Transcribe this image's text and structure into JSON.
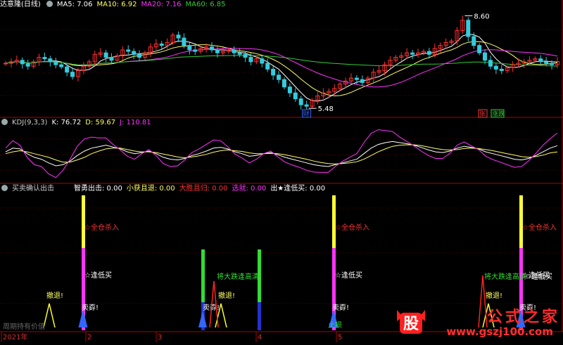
{
  "window": {
    "title": "达意隆(日线)"
  },
  "price_panel": {
    "title": "达意隆(日线)",
    "indicators": [
      {
        "label": "MA5: 7.06",
        "color": "#ffffff"
      },
      {
        "label": "MA10: 6.92",
        "color": "#ffff66"
      },
      {
        "label": "MA20: 7.16",
        "color": "#ff33ff"
      },
      {
        "label": "MA60: 6.85",
        "color": "#33cc33"
      }
    ],
    "high_label": "8.60",
    "low_label": "5.48",
    "tags": [
      {
        "text": "财",
        "color": "#3366ff"
      },
      {
        "text": "张",
        "color": "#ff3333"
      },
      {
        "text": "涨跌",
        "color": "#33cc33"
      }
    ]
  },
  "kdj_panel": {
    "title": "KDJ(9,3,3)",
    "indicators": [
      {
        "label": "K: 76.72",
        "color": "#ffffff"
      },
      {
        "label": "D: 59.67",
        "color": "#ffff66"
      },
      {
        "label": "J: 110.81",
        "color": "#ff33ff"
      }
    ]
  },
  "signal_panel": {
    "title": "买卖确认出击",
    "indicators": [
      {
        "label": "智勇出击: 0.00",
        "color": "#ffffff"
      },
      {
        "label": "小获且退: 0.00",
        "color": "#ffff66"
      },
      {
        "label": "大胜且归: 0.00",
        "color": "#ff3333"
      },
      {
        "label": "选就: 0.00",
        "color": "#ff33ff"
      },
      {
        "label": "出★逢低买: 0.00",
        "color": "#ffffff"
      }
    ],
    "labels": {
      "full_buy": "☆全仓杀入",
      "dip_buy": "☆逢低买",
      "retreat": "撤退!",
      "sell": "卖孬!",
      "big_drop": "将大跌逢高清",
      "stop_loss": "止损",
      "blurred": "周期持有价值"
    }
  },
  "x_axis": {
    "labels": [
      "2021年",
      "2",
      "3",
      "4",
      "5"
    ]
  },
  "watermark": {
    "text": "公式之家",
    "url": "www.gszj100.com",
    "logo": "股"
  },
  "chart_data": [
    {
      "type": "candlestick",
      "title": "达意隆(日线)",
      "series_names": [
        "MA5",
        "MA10",
        "MA20",
        "MA60"
      ],
      "x": [
        "2021年",
        "2",
        "3",
        "4",
        "5"
      ],
      "ylim": [
        5.2,
        8.8
      ],
      "annotated_high": 8.6,
      "annotated_low": 5.48,
      "ma_values_last": {
        "MA5": 7.06,
        "MA10": 6.92,
        "MA20": 7.16,
        "MA60": 6.85
      },
      "close": [
        7.0,
        7.05,
        7.1,
        6.98,
        6.9,
        7.05,
        7.2,
        7.15,
        7.05,
        6.95,
        6.88,
        6.7,
        6.55,
        6.75,
        6.9,
        7.05,
        7.3,
        7.35,
        7.2,
        7.1,
        7.25,
        7.45,
        7.4,
        7.3,
        7.2,
        7.35,
        7.55,
        7.65,
        7.6,
        7.7,
        7.95,
        7.85,
        7.6,
        7.45,
        7.4,
        7.5,
        7.55,
        7.45,
        7.35,
        7.4,
        7.45,
        7.35,
        7.3,
        7.2,
        7.05,
        7.15,
        7.0,
        6.8,
        6.6,
        6.45,
        6.2,
        6.0,
        5.8,
        5.6,
        5.55,
        5.75,
        5.9,
        6.0,
        6.05,
        6.15,
        6.3,
        6.4,
        6.5,
        6.45,
        6.35,
        6.5,
        6.7,
        6.75,
        6.95,
        7.1,
        7.2,
        7.25,
        7.35,
        7.3,
        7.35,
        7.4,
        7.3,
        7.5,
        7.6,
        7.7,
        7.75,
        8.1,
        8.45,
        7.9,
        7.6,
        7.35,
        7.1,
        6.9,
        6.8,
        6.75,
        6.85,
        6.95,
        7.0,
        7.05,
        7.1,
        7.15,
        7.05,
        7.0,
        6.95,
        7.06
      ]
    },
    {
      "type": "line",
      "title": "KDJ(9,3,3)",
      "series": [
        {
          "name": "K",
          "values": [
            60,
            70,
            68,
            55,
            45,
            40,
            30,
            22,
            25,
            35,
            50,
            62,
            70,
            74,
            78,
            73,
            68,
            60,
            55,
            58,
            62,
            55,
            45,
            40,
            38,
            42,
            50,
            55,
            62,
            70,
            72,
            68,
            60,
            55,
            48,
            50,
            55,
            58,
            52,
            45,
            40,
            35,
            30,
            25,
            22,
            20,
            25,
            30,
            35,
            40,
            55,
            70,
            80,
            85,
            88,
            85,
            82,
            78,
            72,
            65,
            60,
            58,
            62,
            70,
            75,
            72,
            68,
            60,
            55,
            50,
            45,
            40,
            38,
            42,
            50,
            60,
            70,
            76.72
          ]
        },
        {
          "name": "D",
          "values": [
            55,
            60,
            63,
            60,
            55,
            50,
            45,
            38,
            32,
            32,
            38,
            45,
            55,
            62,
            68,
            70,
            70,
            66,
            62,
            60,
            60,
            58,
            54,
            50,
            46,
            44,
            46,
            49,
            53,
            59,
            63,
            65,
            63,
            61,
            57,
            55,
            55,
            56,
            55,
            52,
            48,
            44,
            40,
            35,
            31,
            28,
            27,
            28,
            30,
            33,
            40,
            50,
            60,
            68,
            75,
            78,
            79,
            79,
            77,
            73,
            69,
            66,
            65,
            66,
            69,
            70,
            69,
            66,
            63,
            59,
            55,
            51,
            47,
            45,
            47,
            51,
            57,
            59.67
          ]
        },
        {
          "name": "J",
          "values": [
            70,
            90,
            78,
            45,
            25,
            20,
            0,
            -10,
            10,
            40,
            75,
            95,
            100,
            98,
            98,
            80,
            65,
            48,
            40,
            55,
            66,
            50,
            28,
            20,
            22,
            38,
            58,
            68,
            80,
            92,
            90,
            74,
            54,
            43,
            30,
            40,
            55,
            62,
            46,
            32,
            24,
            18,
            10,
            5,
            4,
            4,
            20,
            34,
            45,
            55,
            85,
            110,
            120,
            118,
            115,
            100,
            88,
            76,
            62,
            50,
            42,
            42,
            56,
            78,
            87,
            76,
            66,
            48,
            39,
            32,
            25,
            18,
            20,
            36,
            56,
            78,
            96,
            110.81
          ]
        }
      ],
      "K_last": 76.72,
      "D_last": 59.67,
      "J_last": 110.81
    },
    {
      "type": "bar",
      "title": "买卖确认出击",
      "series": [
        {
          "name": "智勇出击",
          "value": 0.0
        },
        {
          "name": "小获且退",
          "value": 0.0
        },
        {
          "name": "大胜且归",
          "value": 0.0
        },
        {
          "name": "选就",
          "value": 0.0
        },
        {
          "name": "出★逢低买",
          "value": 0.0
        }
      ]
    }
  ]
}
